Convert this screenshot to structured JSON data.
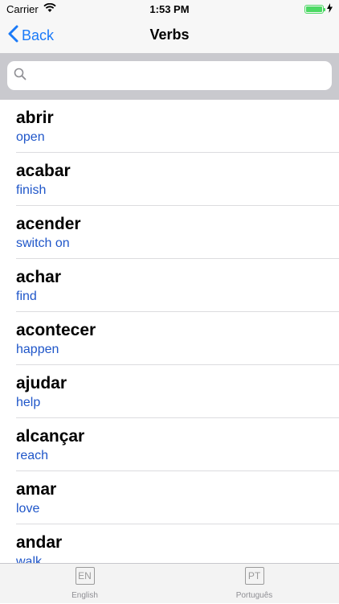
{
  "status_bar": {
    "carrier": "Carrier",
    "time": "1:53 PM",
    "battery_level_percent": 100
  },
  "nav": {
    "back_label": "Back",
    "title": "Verbs"
  },
  "search": {
    "placeholder": ""
  },
  "verbs": [
    {
      "word": "abrir",
      "translation": "open"
    },
    {
      "word": "acabar",
      "translation": "finish"
    },
    {
      "word": "acender",
      "translation": "switch on"
    },
    {
      "word": "achar",
      "translation": "find"
    },
    {
      "word": "acontecer",
      "translation": "happen"
    },
    {
      "word": "ajudar",
      "translation": "help"
    },
    {
      "word": "alcançar",
      "translation": "reach"
    },
    {
      "word": "amar",
      "translation": "love"
    },
    {
      "word": "andar",
      "translation": "walk"
    }
  ],
  "tabs": [
    {
      "icon_text": "EN",
      "label": "English"
    },
    {
      "icon_text": "PT",
      "label": "Português"
    }
  ],
  "colors": {
    "accent": "#1a7af8",
    "translation_text": "#1f56c9",
    "battery": "#4cd964"
  }
}
